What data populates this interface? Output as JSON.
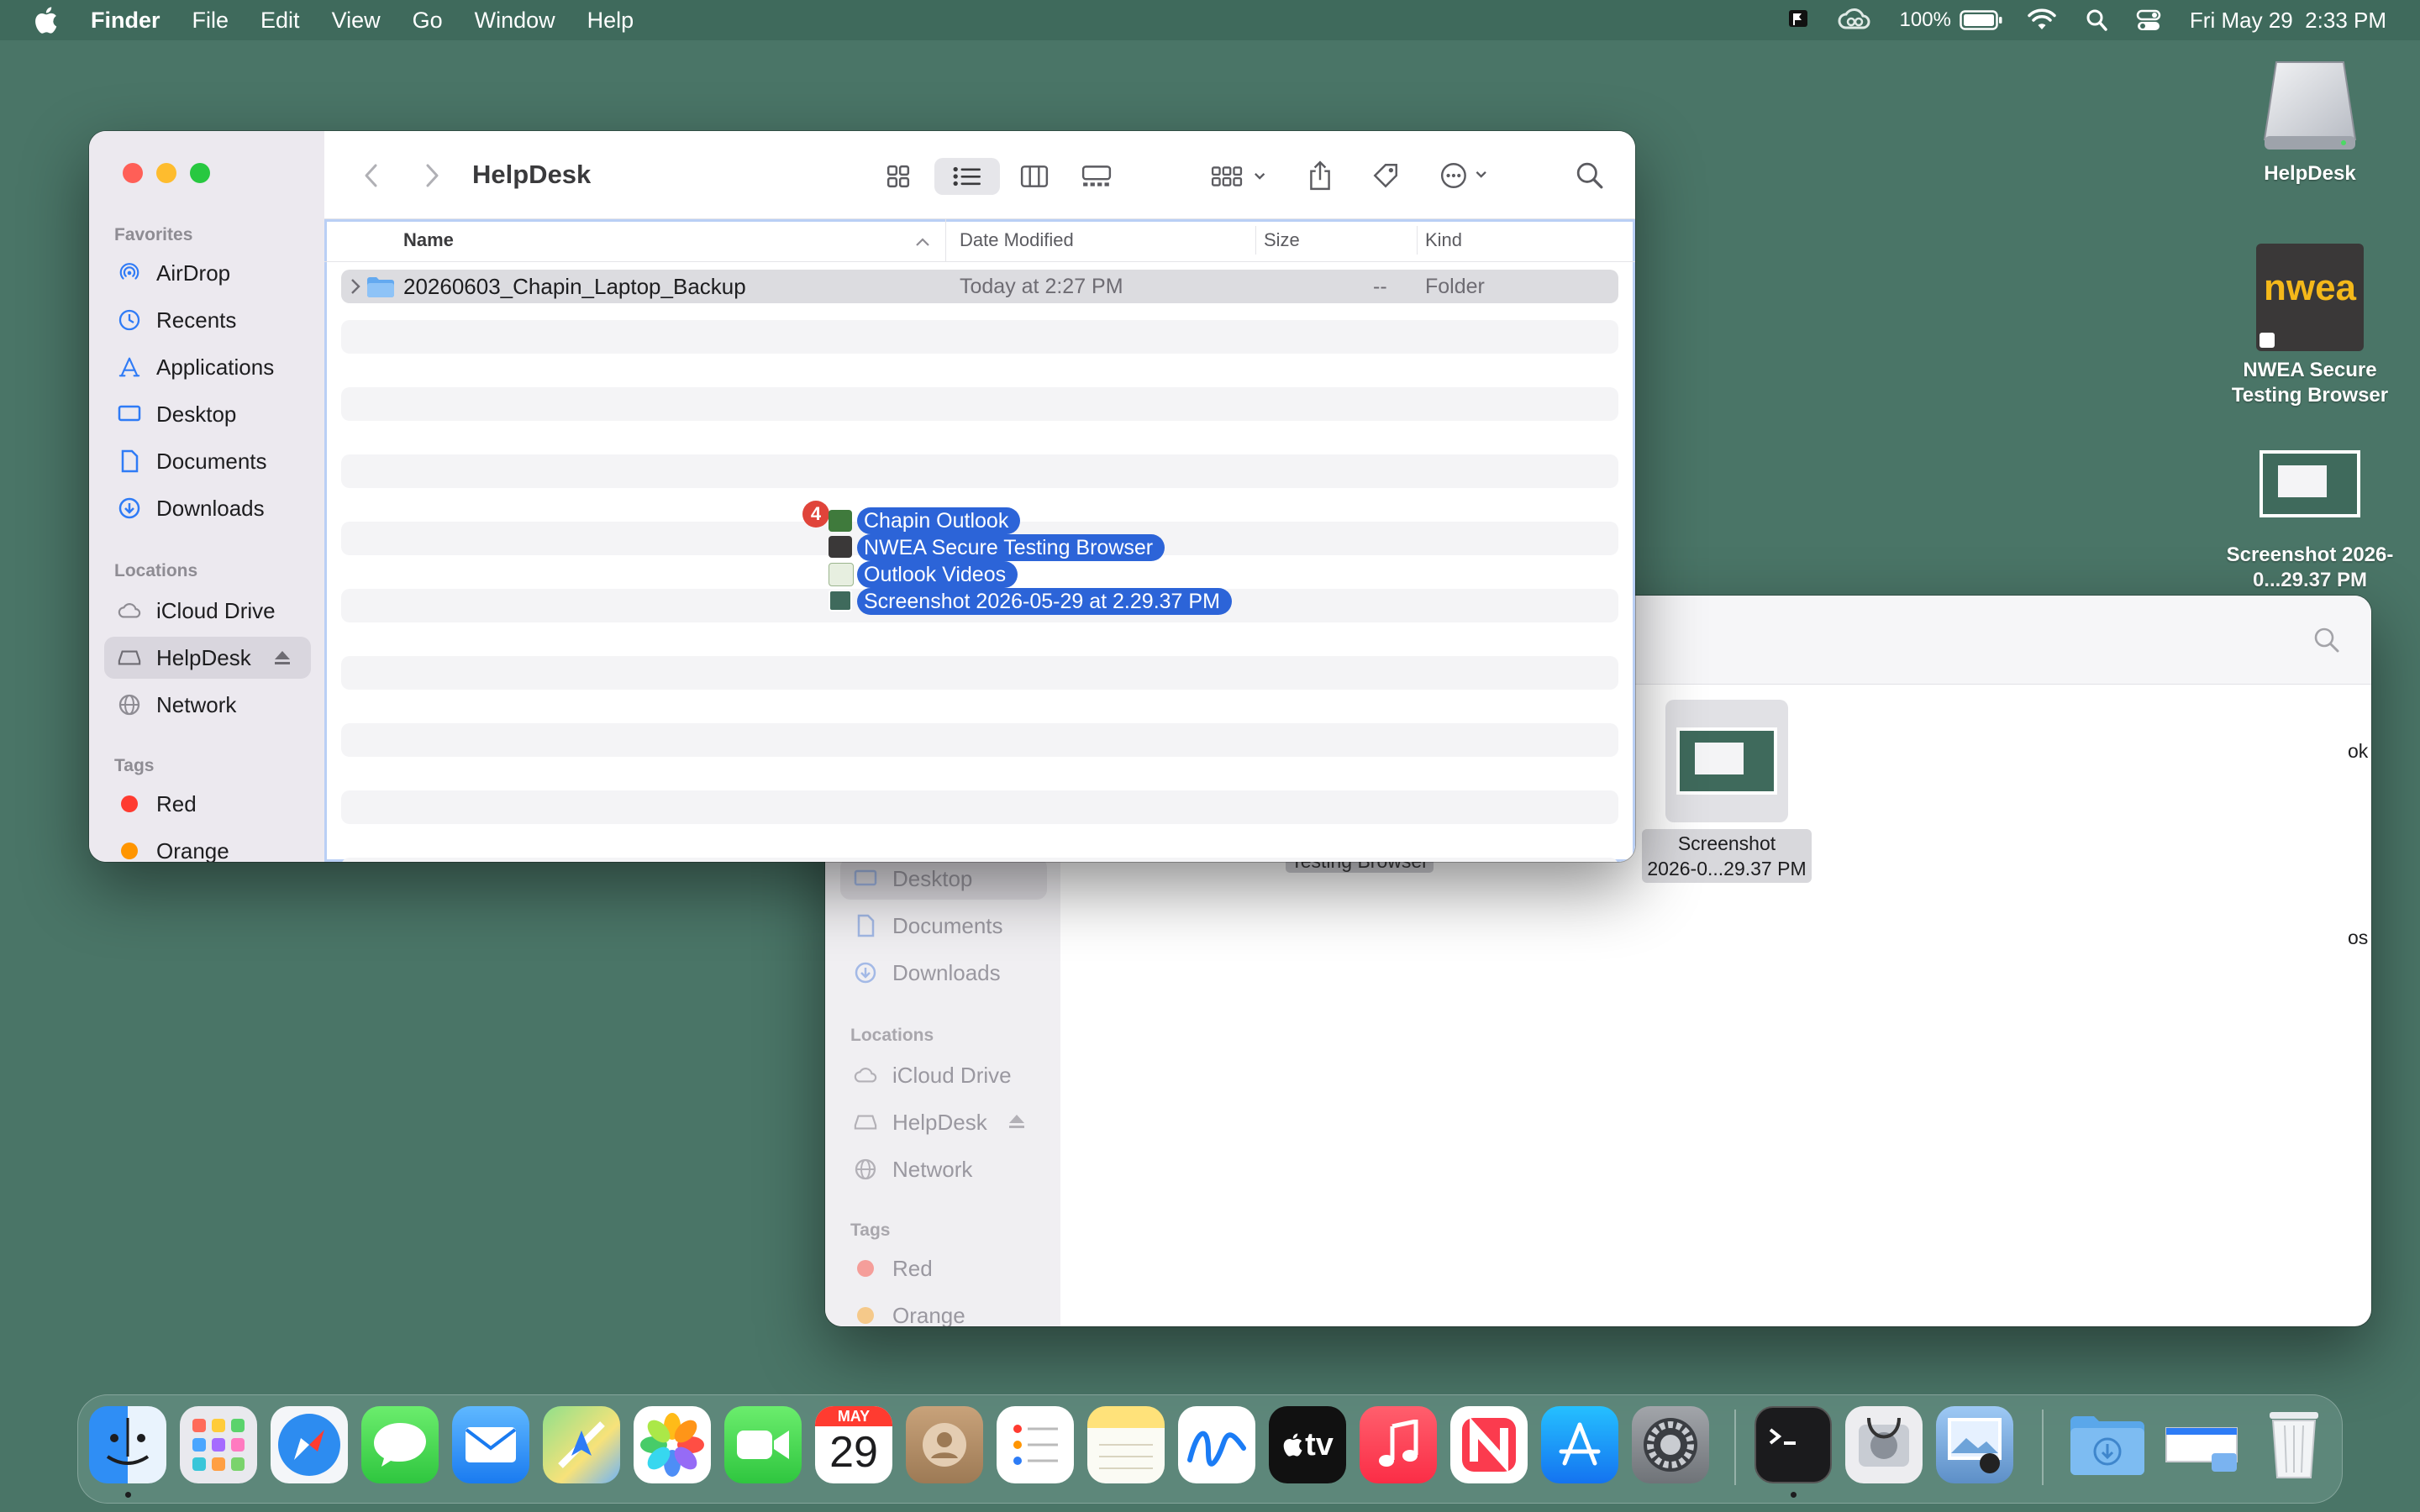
{
  "menubar": {
    "app_name": "Finder",
    "menus": [
      "File",
      "Edit",
      "View",
      "Go",
      "Window",
      "Help"
    ],
    "battery": "100%",
    "clock": "Fri May 29  2:33 PM"
  },
  "desktop": {
    "icons": [
      {
        "label": "HelpDesk",
        "icon": "external-drive-icon"
      },
      {
        "label": "NWEA Secure Testing Browser",
        "icon": "nwea-app-icon",
        "logo_text": "nwea"
      },
      {
        "label": "Screenshot 2026-0...29.37 PM",
        "icon": "screenshot-thumbnail-icon"
      }
    ]
  },
  "front_window": {
    "title": "HelpDesk",
    "sidebar": {
      "favorites_header": "Favorites",
      "favorites": [
        {
          "label": "AirDrop",
          "icon": "airdrop-icon"
        },
        {
          "label": "Recents",
          "icon": "clock-icon"
        },
        {
          "label": "Applications",
          "icon": "applications-icon"
        },
        {
          "label": "Desktop",
          "icon": "desktop-icon"
        },
        {
          "label": "Documents",
          "icon": "document-icon"
        },
        {
          "label": "Downloads",
          "icon": "download-icon"
        }
      ],
      "locations_header": "Locations",
      "locations": [
        {
          "label": "iCloud Drive",
          "icon": "cloud-icon"
        },
        {
          "label": "HelpDesk",
          "icon": "drive-icon",
          "selected": true
        },
        {
          "label": "Network",
          "icon": "globe-icon"
        }
      ],
      "tags_header": "Tags",
      "tags": [
        {
          "label": "Red",
          "color": "#ff3b30"
        },
        {
          "label": "Orange",
          "color": "#ff9500"
        }
      ]
    },
    "columns": {
      "name": "Name",
      "date_modified": "Date Modified",
      "size": "Size",
      "kind": "Kind"
    },
    "rows": [
      {
        "name": "20260603_Chapin_Laptop_Backup",
        "date_modified": "Today at 2:27 PM",
        "size": "--",
        "kind": "Folder"
      }
    ],
    "drag": {
      "badge_count": "4",
      "items": [
        "Chapin Outlook",
        "NWEA Secure Testing Browser",
        "Outlook Videos",
        "Screenshot 2026-05-29 at 2.29.37 PM"
      ]
    }
  },
  "back_window": {
    "sidebar": {
      "items": [
        "Desktop",
        "Documents",
        "Downloads"
      ],
      "locations_header": "Locations",
      "locations": [
        "iCloud Drive",
        "HelpDesk",
        "Network"
      ],
      "tags_header": "Tags",
      "tags": [
        {
          "label": "Red",
          "color": "#f59e9a"
        },
        {
          "label": "Orange",
          "color": "#f5c98a"
        }
      ]
    },
    "files": [
      {
        "label": "Testing Browser"
      },
      {
        "label_line1": "Screenshot",
        "label_line2": "2026-0...29.37 PM"
      }
    ],
    "edge_fragments": [
      "ok",
      "os"
    ]
  },
  "dock": {
    "calendar_month": "MAY",
    "calendar_day": "29",
    "tv_label": "tv"
  }
}
